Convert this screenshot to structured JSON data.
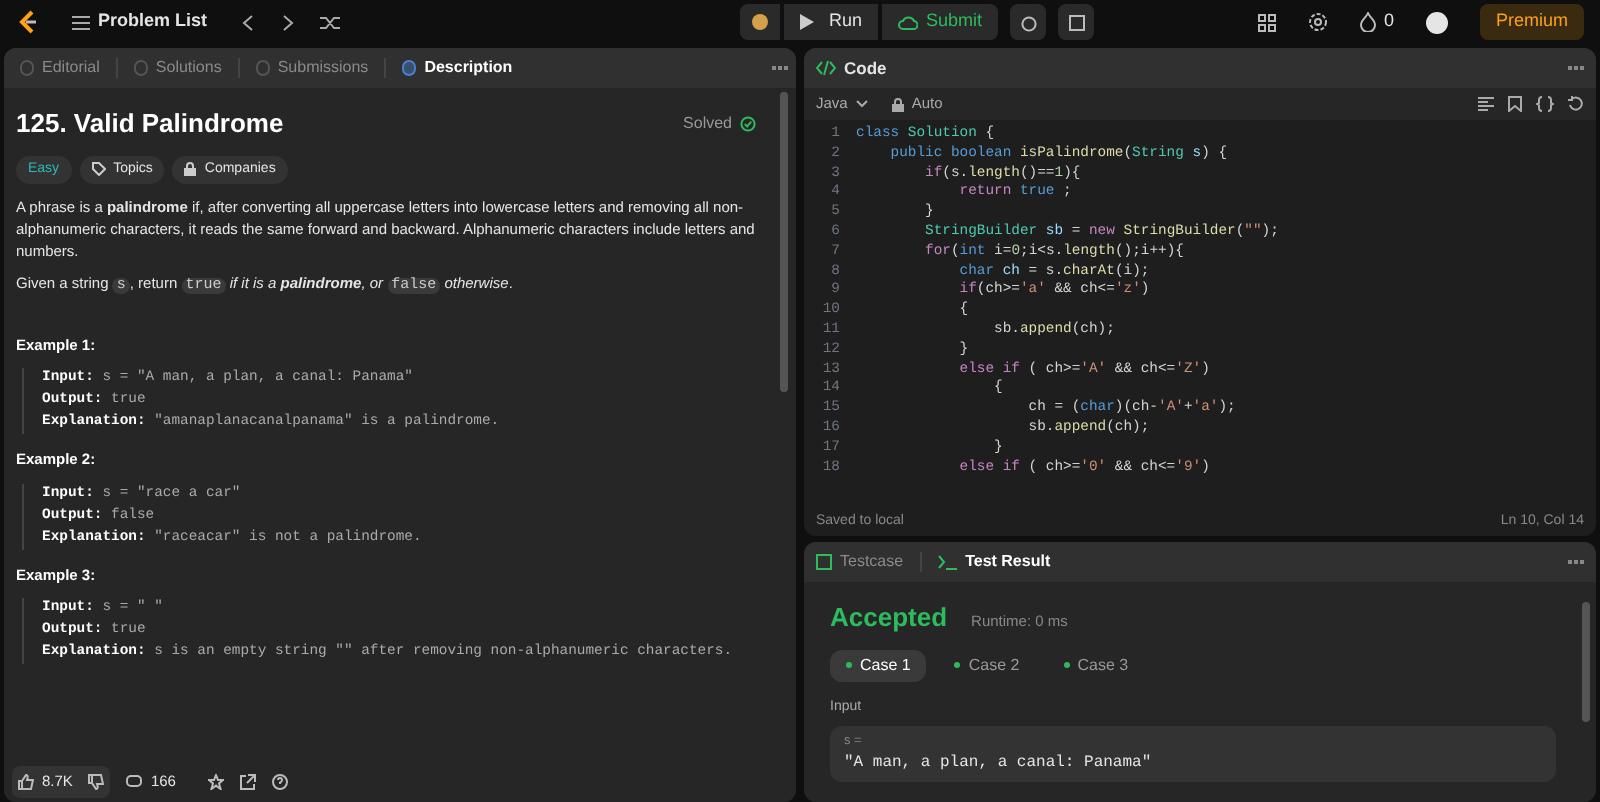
{
  "topbar": {
    "problem_list": "Problem List",
    "run": "Run",
    "submit": "Submit",
    "points": "0",
    "premium": "Premium"
  },
  "left_tabs": [
    {
      "label": "Editorial",
      "selected": false
    },
    {
      "label": "Solutions",
      "selected": false
    },
    {
      "label": "Submissions",
      "selected": false
    },
    {
      "label": "Description",
      "selected": true
    }
  ],
  "problem": {
    "title": "125. Valid Palindrome",
    "status": "Solved",
    "difficulty": "Easy",
    "tags": [
      "Topics",
      "Companies"
    ],
    "intro": "A phrase is a **palindrome** if, after converting all uppercase letters into lowercase letters and removing all non-alphanumeric characters, it reads the same forward and backward. Alphanumeric characters include letters and numbers.",
    "task": [
      {
        "kind": "text",
        "text": "Given a string "
      },
      {
        "kind": "code",
        "text": "s"
      },
      {
        "kind": "text",
        "text": ", return "
      },
      {
        "kind": "code",
        "text": "true"
      },
      {
        "kind": "em",
        "text": " if it is a "
      },
      {
        "kind": "strong_em",
        "text": "palindrome"
      },
      {
        "kind": "em",
        "text": ", or "
      },
      {
        "kind": "code",
        "text": "false"
      },
      {
        "kind": "em",
        "text": " otherwise"
      },
      {
        "kind": "text",
        "text": "."
      }
    ],
    "examples": [
      {
        "title": "Example 1:",
        "lines": [
          {
            "label": "Input:",
            "value": "s = \"A man, a plan, a canal: Panama\""
          },
          {
            "label": "Output:",
            "value": "true"
          },
          {
            "label": "Explanation:",
            "value": "\"amanaplanacanalpanama\" is a palindrome."
          }
        ]
      },
      {
        "title": "Example 2:",
        "lines": [
          {
            "label": "Input:",
            "value": "s = \"race a car\""
          },
          {
            "label": "Output:",
            "value": "false"
          },
          {
            "label": "Explanation:",
            "value": "\"raceacar\" is not a palindrome."
          }
        ]
      },
      {
        "title": "Example 3:",
        "lines": [
          {
            "label": "Input:",
            "value": "s = \" \""
          },
          {
            "label": "Output:",
            "value": "true"
          },
          {
            "label": "Explanation:",
            "value": "s is an empty string \"\" after removing non-alphanumeric characters."
          }
        ]
      }
    ]
  },
  "footer": {
    "likes": "8.7K",
    "comments": "166"
  },
  "code_panel": {
    "title": "Code",
    "language": "Java",
    "mode": "Auto",
    "saved": "Saved to local",
    "cursor": "Ln 10, Col 14",
    "lines": [
      {
        "number": "1",
        "tokens": [
          {
            "kind": "kw",
            "text": "class "
          },
          {
            "kind": "type",
            "text": "Solution"
          },
          {
            "kind": "plain",
            "text": " {"
          }
        ]
      },
      {
        "number": "2",
        "tokens": [
          {
            "kind": "kw",
            "text": "    public boolean "
          },
          {
            "kind": "fn",
            "text": "isPalindrome"
          },
          {
            "kind": "plain",
            "text": "("
          },
          {
            "kind": "type",
            "text": "String"
          },
          {
            "kind": "var",
            "text": " s"
          },
          {
            "kind": "plain",
            "text": ") {"
          }
        ]
      },
      {
        "number": "3",
        "tokens": [
          {
            "kind": "ctl",
            "text": "        if"
          },
          {
            "kind": "plain",
            "text": "(s."
          },
          {
            "kind": "fn",
            "text": "length"
          },
          {
            "kind": "plain",
            "text": "()=="
          },
          {
            "kind": "num",
            "text": "1"
          },
          {
            "kind": "plain",
            "text": "){"
          }
        ]
      },
      {
        "number": "4",
        "tokens": [
          {
            "kind": "ctl",
            "text": "            return "
          },
          {
            "kind": "kw",
            "text": "true"
          },
          {
            "kind": "plain",
            "text": " ;"
          }
        ]
      },
      {
        "number": "5",
        "tokens": [
          {
            "kind": "plain",
            "text": "        }"
          }
        ]
      },
      {
        "number": "6",
        "tokens": [
          {
            "kind": "type",
            "text": "        StringBuilder"
          },
          {
            "kind": "var",
            "text": " sb"
          },
          {
            "kind": "plain",
            "text": " = "
          },
          {
            "kind": "ctl",
            "text": "new "
          },
          {
            "kind": "fn",
            "text": "StringBuilder"
          },
          {
            "kind": "plain",
            "text": "("
          },
          {
            "kind": "str",
            "text": "\"\""
          },
          {
            "kind": "plain",
            "text": ");"
          }
        ]
      },
      {
        "number": "7",
        "tokens": [
          {
            "kind": "ctl",
            "text": "        for"
          },
          {
            "kind": "plain",
            "text": "("
          },
          {
            "kind": "kw",
            "text": "int"
          },
          {
            "kind": "plain",
            "text": " i="
          },
          {
            "kind": "num",
            "text": "0"
          },
          {
            "kind": "plain",
            "text": ";i<s."
          },
          {
            "kind": "fn",
            "text": "length"
          },
          {
            "kind": "plain",
            "text": "();i++){"
          }
        ]
      },
      {
        "number": "8",
        "tokens": [
          {
            "kind": "kw",
            "text": "            char"
          },
          {
            "kind": "var",
            "text": " ch"
          },
          {
            "kind": "plain",
            "text": " = s."
          },
          {
            "kind": "fn",
            "text": "charAt"
          },
          {
            "kind": "plain",
            "text": "(i);"
          }
        ]
      },
      {
        "number": "9",
        "tokens": [
          {
            "kind": "ctl",
            "text": "            if"
          },
          {
            "kind": "plain",
            "text": "(ch>="
          },
          {
            "kind": "str",
            "text": "'a'"
          },
          {
            "kind": "plain",
            "text": " && ch<="
          },
          {
            "kind": "str",
            "text": "'z'"
          },
          {
            "kind": "plain",
            "text": ")"
          }
        ]
      },
      {
        "number": "10",
        "tokens": [
          {
            "kind": "plain",
            "text": "            {"
          }
        ]
      },
      {
        "number": "11",
        "tokens": [
          {
            "kind": "plain",
            "text": "                sb."
          },
          {
            "kind": "fn",
            "text": "append"
          },
          {
            "kind": "plain",
            "text": "(ch);"
          }
        ]
      },
      {
        "number": "12",
        "tokens": [
          {
            "kind": "plain",
            "text": "            }"
          }
        ]
      },
      {
        "number": "13",
        "tokens": [
          {
            "kind": "ctl",
            "text": "            else if"
          },
          {
            "kind": "plain",
            "text": " ( ch>="
          },
          {
            "kind": "str",
            "text": "'A'"
          },
          {
            "kind": "plain",
            "text": " && ch<="
          },
          {
            "kind": "str",
            "text": "'Z'"
          },
          {
            "kind": "plain",
            "text": ")"
          }
        ]
      },
      {
        "number": "14",
        "tokens": [
          {
            "kind": "plain",
            "text": "                {"
          }
        ]
      },
      {
        "number": "15",
        "tokens": [
          {
            "kind": "plain",
            "text": "                    ch = ("
          },
          {
            "kind": "kw",
            "text": "char"
          },
          {
            "kind": "plain",
            "text": ")(ch-"
          },
          {
            "kind": "str",
            "text": "'A'"
          },
          {
            "kind": "plain",
            "text": "+"
          },
          {
            "kind": "str",
            "text": "'a'"
          },
          {
            "kind": "plain",
            "text": ");"
          }
        ]
      },
      {
        "number": "16",
        "tokens": [
          {
            "kind": "plain",
            "text": "                    sb."
          },
          {
            "kind": "fn",
            "text": "append"
          },
          {
            "kind": "plain",
            "text": "(ch);"
          }
        ]
      },
      {
        "number": "17",
        "tokens": [
          {
            "kind": "plain",
            "text": "                }"
          }
        ]
      },
      {
        "number": "18",
        "tokens": [
          {
            "kind": "ctl",
            "text": "            else if"
          },
          {
            "kind": "plain",
            "text": " ( ch>="
          },
          {
            "kind": "str",
            "text": "'0'"
          },
          {
            "kind": "plain",
            "text": " && ch<="
          },
          {
            "kind": "str",
            "text": "'9'"
          },
          {
            "kind": "plain",
            "text": ")"
          }
        ]
      }
    ]
  },
  "test_panel": {
    "tabs": [
      {
        "label": "Testcase",
        "selected": false
      },
      {
        "label": "Test Result",
        "selected": true
      }
    ],
    "result": "Accepted",
    "runtime": "Runtime: 0 ms",
    "cases": [
      {
        "label": "Case 1",
        "selected": true
      },
      {
        "label": "Case 2",
        "selected": false
      },
      {
        "label": "Case 3",
        "selected": false
      }
    ],
    "input_label": "Input",
    "input_var": "s =",
    "input_value": "\"A man, a plan, a canal: Panama\""
  }
}
